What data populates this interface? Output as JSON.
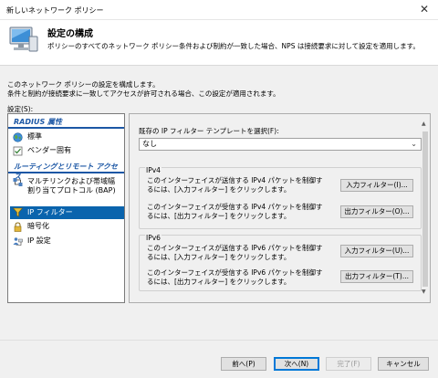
{
  "window": {
    "title": "新しいネットワーク ポリシー",
    "close_glyph": "✕"
  },
  "header": {
    "icon": "computer-monitor-icon",
    "title": "設定の構成",
    "description": "ポリシーのすべてのネットワーク ポリシー条件および制約が一致した場合、NPS は接続要求に対して設定を適用します。"
  },
  "intro": {
    "line1": "このネットワーク ポリシーの設定を構成します。",
    "line2": "条件と制約が接続要求に一致してアクセスが許可される場合、この設定が適用されます。"
  },
  "settings_label": "設定(S):",
  "sidebar": {
    "categories": [
      {
        "label": "RADIUS 属性"
      },
      {
        "label": "ルーティングとリモート アクセス"
      }
    ],
    "items": [
      {
        "label": "標準",
        "icon": "globe-icon"
      },
      {
        "label": "ベンダー固有",
        "icon": "checkbox-icon"
      },
      {
        "label": "マルチリンクおよび帯域幅割り当てプロトコル (BAP)",
        "icon": "network-link-icon"
      },
      {
        "label": "IP フィルター",
        "icon": "filter-funnel-icon",
        "selected": true
      },
      {
        "label": "暗号化",
        "icon": "lock-icon"
      },
      {
        "label": "IP 設定",
        "icon": "network-users-icon"
      }
    ]
  },
  "main": {
    "template_label": "既存の IP フィルター テンプレートを選択(F):",
    "template_value": "なし",
    "ipv4": {
      "label": "IPv4",
      "out_desc": "このインターフェイスが送信する IPv4 パケットを制御するには、[入力フィルター] をクリックします。",
      "in_button": "入力フィルター(I)...",
      "in_desc": "このインターフェイスが受信する IPv4 パケットを制御するには、[出力フィルター] をクリックします。",
      "out_button": "出力フィルター(O)..."
    },
    "ipv6": {
      "label": "IPv6",
      "out_desc": "このインターフェイスが送信する IPv6 パケットを制御するには、[入力フィルター] をクリックします。",
      "in_button": "入力フィルター(U)...",
      "in_desc": "このインターフェイスが受信する IPv6 パケットを制御するには、[出力フィルター] をクリックします。",
      "out_button": "出力フィルター(T)..."
    }
  },
  "footer": {
    "prev": "前へ(P)",
    "next": "次へ(N)",
    "finish": "完了(F)",
    "cancel": "キャンセル"
  },
  "colors": {
    "accent": "#1c57a5",
    "selected_bg": "#0a64ad"
  }
}
